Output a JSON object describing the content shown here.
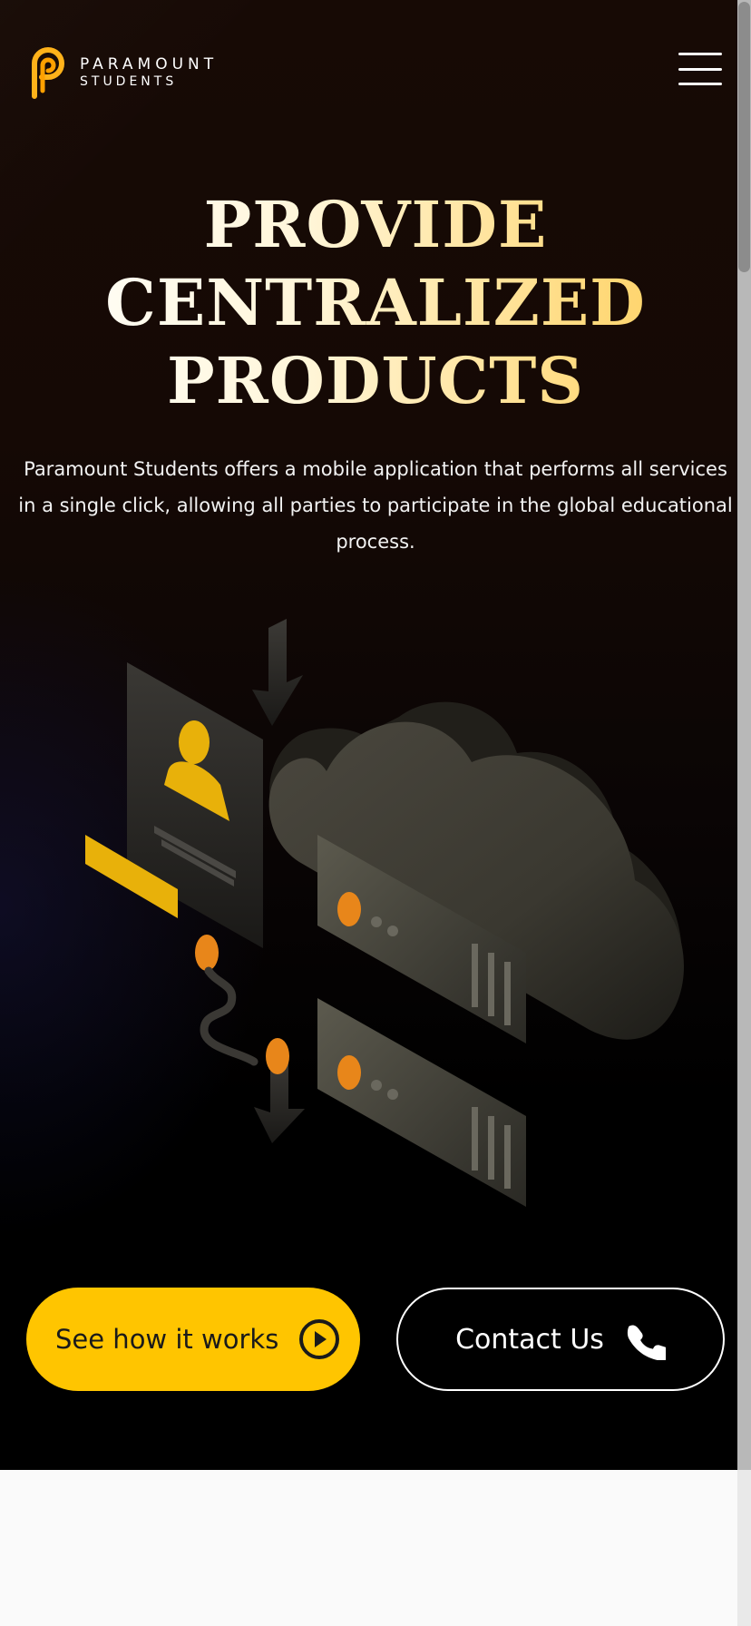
{
  "brand": {
    "line1": "PARAMOUNT",
    "line2": "STUDENTS",
    "logo_icon": "paramount-p-logo",
    "accent_color": "#ffb21a"
  },
  "nav": {
    "menu_icon": "hamburger-menu-icon"
  },
  "hero": {
    "headline_lines": [
      "PROVIDE",
      "CENTRALIZED",
      "PRODUCTS"
    ],
    "description": "Paramount Students offers a mobile application that performs all services in a single click, allowing all parties to participate in the global educational process.",
    "illustration": "cloud-servers-user-illustration"
  },
  "actions": {
    "primary_label": "See how it works",
    "primary_icon": "play-circle-icon",
    "primary_color": "#ffc500",
    "secondary_label": "Contact Us",
    "secondary_icon": "phone-icon"
  }
}
